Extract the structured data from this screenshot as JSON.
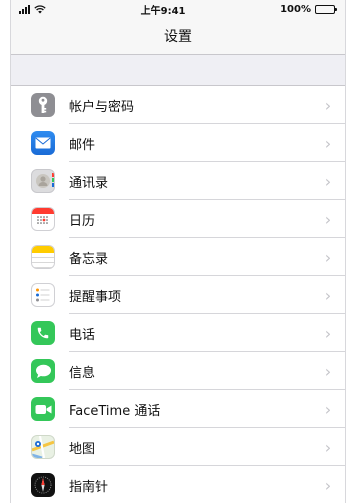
{
  "status_bar": {
    "time": "上午9:41",
    "battery": "100%"
  },
  "nav": {
    "title": "设置"
  },
  "settings_items": [
    {
      "label": "帐户与密码",
      "icon": "key-icon"
    },
    {
      "label": "邮件",
      "icon": "mail-icon"
    },
    {
      "label": "通讯录",
      "icon": "contacts-icon"
    },
    {
      "label": "日历",
      "icon": "calendar-icon"
    },
    {
      "label": "备忘录",
      "icon": "notes-icon"
    },
    {
      "label": "提醒事项",
      "icon": "reminders-icon"
    },
    {
      "label": "电话",
      "icon": "phone-icon"
    },
    {
      "label": "信息",
      "icon": "messages-icon"
    },
    {
      "label": "FaceTime 通话",
      "icon": "facetime-icon"
    },
    {
      "label": "地图",
      "icon": "maps-icon"
    },
    {
      "label": "指南针",
      "icon": "compass-icon"
    }
  ],
  "colors": {
    "green": "#34c759",
    "mail_blue": "#1a6bd6",
    "gray": "#8e8e93",
    "background": "#efeff4"
  }
}
